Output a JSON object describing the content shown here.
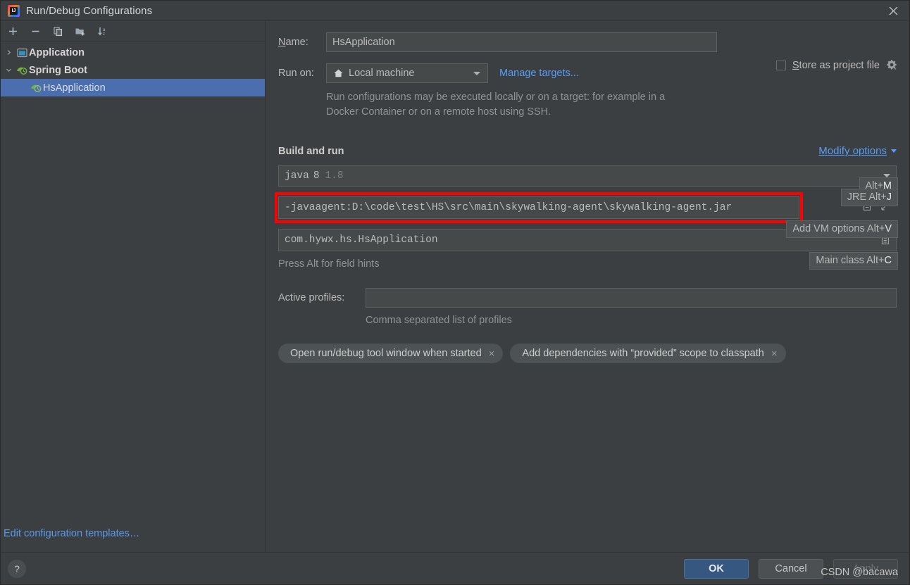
{
  "window": {
    "title": "Run/Debug Configurations",
    "app_icon": "intellij-idea-icon",
    "close_label": "✕"
  },
  "sidebar": {
    "toolbar": [
      {
        "name": "add-configuration-button",
        "icon": "plus-icon"
      },
      {
        "name": "remove-configuration-button",
        "icon": "minus-icon"
      },
      {
        "name": "copy-configuration-button",
        "icon": "copy-icon"
      },
      {
        "name": "new-folder-button",
        "icon": "folder-add-icon"
      },
      {
        "name": "sort-configurations-button",
        "icon": "sort-alphabetical-icon"
      }
    ],
    "tree": [
      {
        "label": "Application",
        "icon": "application-icon",
        "twisty": "›",
        "group": true,
        "selected": false,
        "indent": 0
      },
      {
        "label": "Spring Boot",
        "icon": "spring-boot-icon",
        "twisty": "⌄",
        "group": true,
        "selected": false,
        "indent": 0
      },
      {
        "label": "HsApplication",
        "icon": "spring-boot-icon",
        "twisty": "",
        "group": false,
        "selected": true,
        "indent": 2
      }
    ],
    "edit_templates_link": "Edit configuration templates…"
  },
  "form": {
    "name_label": "Name:",
    "name_mnemonic": "N",
    "name_label_rest": "ame:",
    "name_value": "HsApplication",
    "store_as_project_file": {
      "label": "Store as project file",
      "mnemonic": "S",
      "label_rest": "tore as project file",
      "checked": false,
      "gear_icon": "gear-dropdown-icon"
    },
    "run_on_label": "Run on:",
    "run_on_value": "Local machine",
    "run_on_icon": "home-icon",
    "manage_targets_link": "Manage targets...",
    "target_help_text": "Run configurations may be executed locally or on a target: for example in a Docker Container or on a remote host using SSH.",
    "section_title": "Build and run",
    "modify_options_label": "Modify options",
    "modify_options_mnemonic": "M",
    "modify_options_rest": "odify options",
    "jre_major": "8",
    "jre_runtime_label": "java",
    "jre_version": "1.8",
    "vm_options_value": "-javaagent:D:\\code\\test\\HS\\src\\main\\skywalking-agent\\skywalking-agent.jar",
    "vm_expand_icon": "expand-icon",
    "vm_list_icon": "macro-list-icon",
    "main_class_value": "com.hywx.hs.HsApplication",
    "main_class_browse_icon": "browse-class-icon",
    "field_hint": "Press Alt for field hints",
    "active_profiles_label": "Active profiles:",
    "active_profiles_value": "",
    "active_profiles_hint": "Comma separated list of profiles",
    "chips": [
      {
        "label": "Open run/debug tool window when started",
        "close": "×"
      },
      {
        "label": "Add dependencies with “provided” scope to classpath",
        "close": "×"
      }
    ]
  },
  "hints": [
    {
      "id": "hint-modify",
      "text": "Alt+",
      "mnemonic": "M"
    },
    {
      "id": "hint-jre",
      "text": "JRE Alt+",
      "mnemonic": "J"
    },
    {
      "id": "hint-vm",
      "text": "Add VM options Alt+",
      "mnemonic": "V"
    },
    {
      "id": "hint-main",
      "text": "Main class Alt+",
      "mnemonic": "C"
    }
  ],
  "footer": {
    "help_icon": "question-mark-icon",
    "ok_label": "OK",
    "cancel_label": "Cancel",
    "apply_label": "Apply",
    "watermark": "CSDN @bacawa"
  },
  "colors": {
    "background": "#3c3f41",
    "field_background": "#45494a",
    "selection_blue": "#4b6eaf",
    "link_blue": "#589df6",
    "primary_button": "#365880",
    "annotation_red": "#ff0000",
    "spring_green": "#6db33f"
  }
}
